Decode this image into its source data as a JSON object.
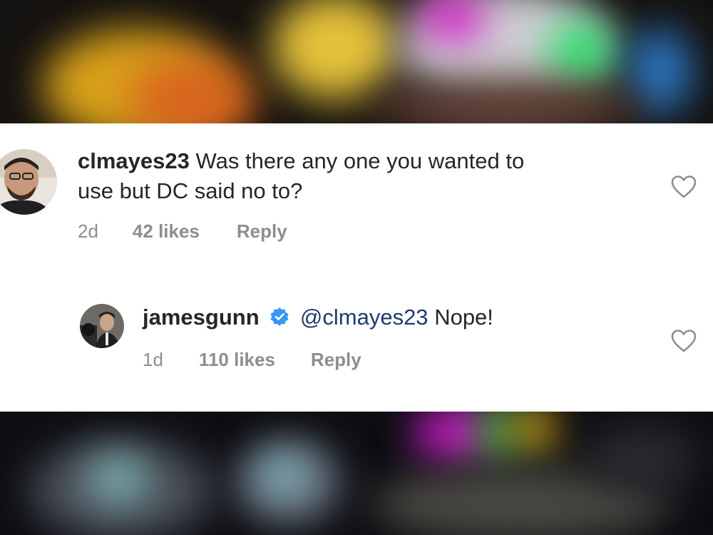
{
  "comments": [
    {
      "username": "clmayes23",
      "text_line1": "Was there any one you wanted to",
      "text_line2": "use but DC said no to?",
      "age": "2d",
      "likes": "42 likes",
      "reply_label": "Reply"
    }
  ],
  "reply": {
    "username": "jamesgunn",
    "mention": "@clmayes23",
    "text": "Nope!",
    "age": "1d",
    "likes": "110 likes",
    "reply_label": "Reply"
  },
  "icons": {
    "like": "heart-outline-icon",
    "verified": "verified-badge-icon"
  },
  "colors": {
    "text": "#262626",
    "meta": "#8e8e8e",
    "mention": "#1d3b70",
    "verified": "#3897f0"
  }
}
